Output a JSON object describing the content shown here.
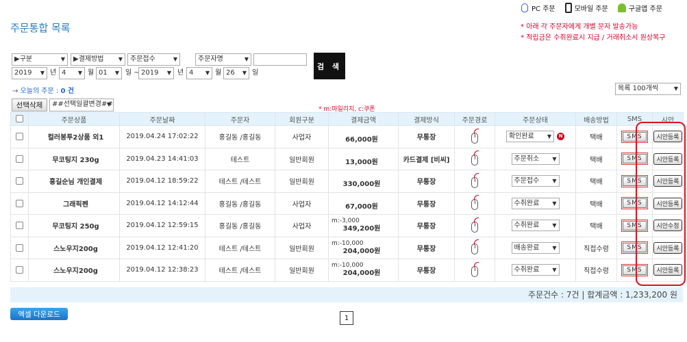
{
  "title": "주문통합 목록",
  "order_links": [
    {
      "label": "PC 주문",
      "icon": "pc-mouse-icon"
    },
    {
      "label": "모바일 주문",
      "icon": "mobile-icon"
    },
    {
      "label": "구글앱 주문",
      "icon": "android-icon"
    }
  ],
  "notes": [
    "아래 각 주문자에게 개별 문자 발송가능",
    "적립금은 수취완료시 지급 / 거래취소시 원상복구"
  ],
  "filters": {
    "type": "▶구분",
    "payment": "▶결제방법",
    "order_status": "주문접수",
    "search_field": "주문자명",
    "search_value": "",
    "search_button": "검 색",
    "from_year": "2019",
    "from_month": "4",
    "from_day": "01",
    "to_year": "2019",
    "to_month": "4",
    "to_day": "26",
    "unit_year": "년",
    "unit_month": "월",
    "unit_day_tilde": "일 ~",
    "unit_day": "일"
  },
  "today_orders": {
    "label": "→ 오늘의 주문 :",
    "count": "0 건"
  },
  "list_size": "목록 100개씩",
  "bulk": {
    "delete_button": "선택삭제",
    "bulk_change": "##선택일괄변경##"
  },
  "legend": "* m:마일리지, c:쿠폰",
  "columns": [
    "주문상품",
    "주문날짜",
    "주문자",
    "회원구분",
    "결제금액",
    "결제방식",
    "주문경로",
    "주문상태",
    "배송방법",
    "SMS",
    "시안"
  ],
  "rows": [
    {
      "product": "컬러봉투2상품 외1",
      "date": "2019.04.24 17:02:22",
      "customer": "홍길동 /홍길동",
      "customer_color": "purple",
      "member": "사업자",
      "mileage": "",
      "amount": "66,000원",
      "payment": "무통장",
      "payment_kind": "free",
      "status": "확인완료",
      "new_badge": "N",
      "shipping": "택배",
      "sms": "SMS",
      "sian": "시안등록"
    },
    {
      "product": "무코팅지 230g",
      "date": "2019.04.23 14:41:03",
      "customer": "테스트",
      "customer_color": "purple",
      "member": "일반회원",
      "mileage": "",
      "amount": "13,000원",
      "payment": "카드결제 [비씨]",
      "payment_kind": "card",
      "status": "주문취소",
      "new_badge": "",
      "shipping": "택배",
      "sms": "SMS",
      "sian": "시안등록"
    },
    {
      "product": "홍길순님 개인결제",
      "date": "2019.04.12 18:59:22",
      "customer": "테스트 /테스트",
      "customer_color": "purple",
      "member": "일반회원",
      "mileage": "",
      "amount": "330,000원",
      "payment": "무통장",
      "payment_kind": "free",
      "status": "주문접수",
      "new_badge": "",
      "shipping": "택배",
      "sms": "SMS",
      "sian": "시안등록"
    },
    {
      "product": "그래픽펜",
      "date": "2019.04.12 14:12:44",
      "customer": "홍길동 /홍길동",
      "customer_color": "purple",
      "member": "사업자",
      "mileage": "",
      "amount": "67,000원",
      "payment": "무통장",
      "payment_kind": "free",
      "status": "수취완료",
      "new_badge": "",
      "shipping": "택배",
      "sms": "SMS",
      "sian": "시안등록"
    },
    {
      "product": "무코팅지 250g",
      "date": "2019.04.12 12:59:15",
      "customer": "홍길동 /홍길동",
      "customer_color": "purple",
      "member": "사업자",
      "mileage": "m:-3,000",
      "amount": "349,200원",
      "payment": "무통장",
      "payment_kind": "free",
      "status": "수취완료",
      "new_badge": "",
      "shipping": "택배",
      "sms": "SMS",
      "sian": "시안수정"
    },
    {
      "product": "스노우지200g",
      "date": "2019.04.12 12:41:20",
      "customer": "테스트 /테스트",
      "customer_color": "purple",
      "member": "일반회원",
      "mileage": "m:-10,000",
      "amount": "204,000원",
      "payment": "무통장",
      "payment_kind": "free",
      "status": "배송완료",
      "new_badge": "",
      "shipping": "직접수령",
      "sms": "SMS",
      "sian": "시안등록"
    },
    {
      "product": "스노우지200g",
      "date": "2019.04.12 12:38:23",
      "customer": "테스트 /테스트",
      "customer_color": "purple",
      "member": "일반회원",
      "mileage": "m:-10,000",
      "amount": "204,000원",
      "payment": "무통장",
      "payment_kind": "free",
      "status": "수취완료",
      "new_badge": "",
      "shipping": "직접수령",
      "sms": "SMS",
      "sian": "시안등록"
    }
  ],
  "summary": "주문건수 : 7건 | 합계금액 : 1,233,200 원",
  "excel_button": "엑셀 다운로드",
  "pagination": [
    "1"
  ],
  "colors": {
    "title": "#2a7ec4",
    "notes": "#e0002a",
    "header_bg": "#e4f3fb",
    "highlight_frame": "#e0101e"
  }
}
